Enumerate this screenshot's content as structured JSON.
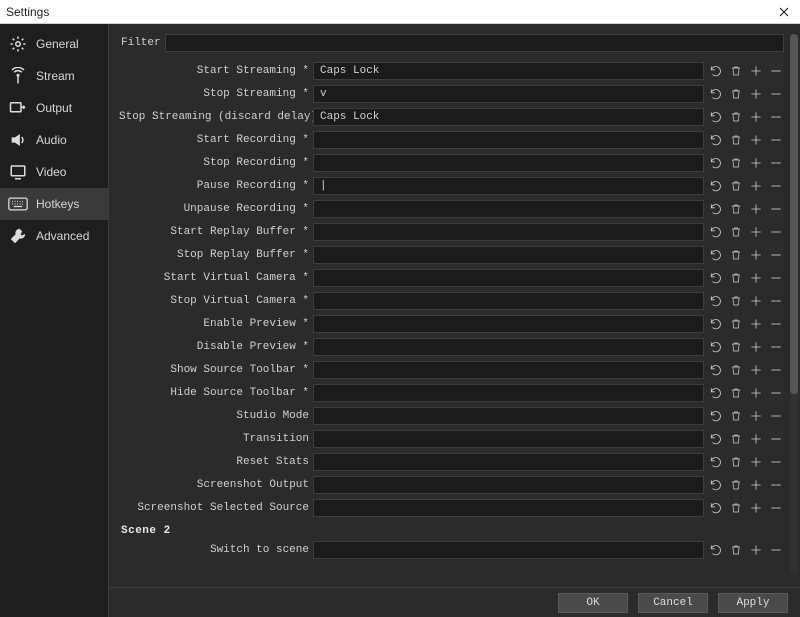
{
  "window": {
    "title": "Settings"
  },
  "sidebar": {
    "items": [
      {
        "label": "General"
      },
      {
        "label": "Stream"
      },
      {
        "label": "Output"
      },
      {
        "label": "Audio"
      },
      {
        "label": "Video"
      },
      {
        "label": "Hotkeys"
      },
      {
        "label": "Advanced"
      }
    ]
  },
  "filter": {
    "label": "Filter",
    "value": ""
  },
  "hotkeys": [
    {
      "label": "Start Streaming *",
      "value": "Caps Lock"
    },
    {
      "label": "Stop Streaming *",
      "value": "v"
    },
    {
      "label": "Stop Streaming (discard delay)",
      "value": "Caps Lock"
    },
    {
      "label": "Start Recording *",
      "value": ""
    },
    {
      "label": "Stop Recording *",
      "value": ""
    },
    {
      "label": "Pause Recording *",
      "value": "|"
    },
    {
      "label": "Unpause Recording *",
      "value": ""
    },
    {
      "label": "Start Replay Buffer *",
      "value": ""
    },
    {
      "label": "Stop Replay Buffer *",
      "value": ""
    },
    {
      "label": "Start Virtual Camera *",
      "value": ""
    },
    {
      "label": "Stop Virtual Camera *",
      "value": ""
    },
    {
      "label": "Enable Preview *",
      "value": ""
    },
    {
      "label": "Disable Preview *",
      "value": ""
    },
    {
      "label": "Show Source Toolbar *",
      "value": ""
    },
    {
      "label": "Hide Source Toolbar *",
      "value": ""
    },
    {
      "label": "Studio Mode",
      "value": ""
    },
    {
      "label": "Transition",
      "value": ""
    },
    {
      "label": "Reset Stats",
      "value": ""
    },
    {
      "label": "Screenshot Output",
      "value": ""
    },
    {
      "label": "Screenshot Selected Source",
      "value": ""
    }
  ],
  "scene2": {
    "title": "Scene 2",
    "row": {
      "label": "Switch to scene",
      "value": ""
    }
  },
  "footer": {
    "ok": "OK",
    "cancel": "Cancel",
    "apply": "Apply"
  }
}
